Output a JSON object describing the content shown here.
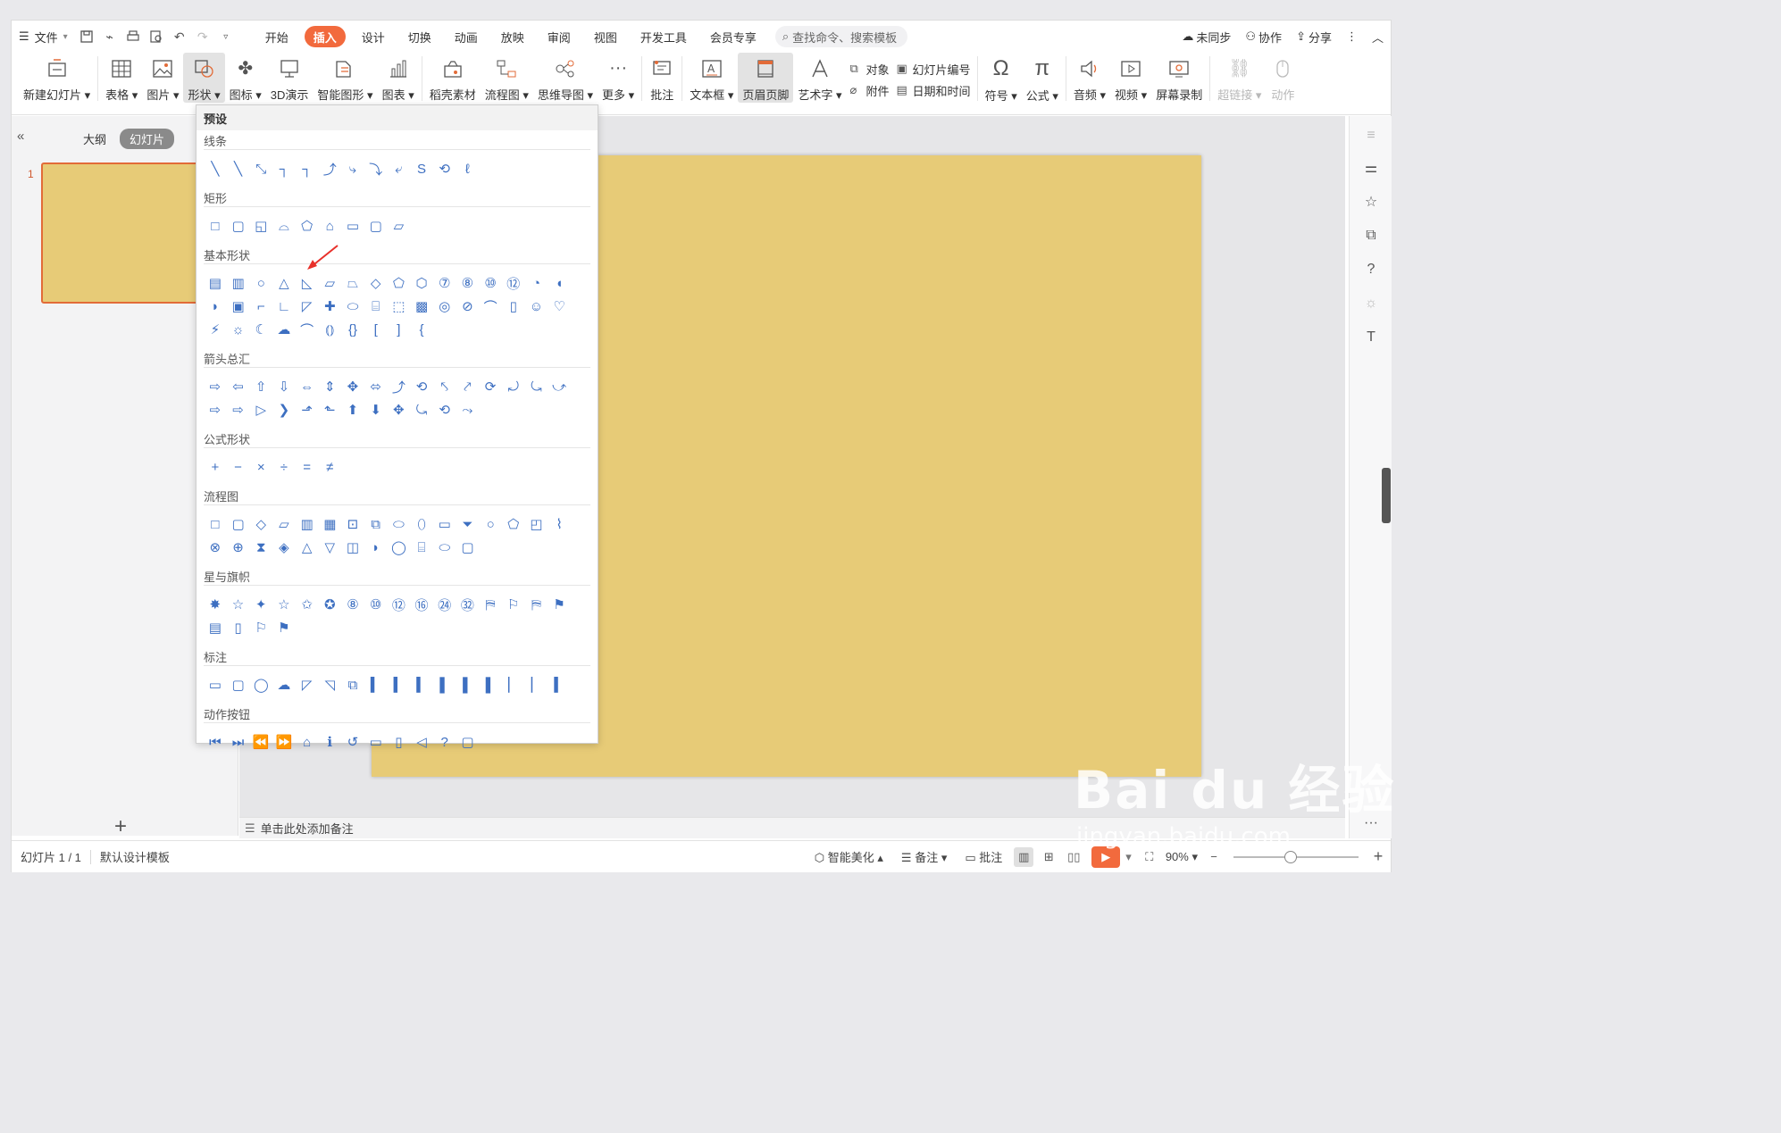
{
  "menubar": {
    "file": "文件",
    "tabs": [
      {
        "label": "开始",
        "active": false
      },
      {
        "label": "插入",
        "active": true
      },
      {
        "label": "设计",
        "active": false
      },
      {
        "label": "切换",
        "active": false
      },
      {
        "label": "动画",
        "active": false
      },
      {
        "label": "放映",
        "active": false
      },
      {
        "label": "审阅",
        "active": false
      },
      {
        "label": "视图",
        "active": false
      },
      {
        "label": "开发工具",
        "active": false
      },
      {
        "label": "会员专享",
        "active": false
      }
    ],
    "search_placeholder": "查找命令、搜索模板",
    "unsynced": "未同步",
    "collaborate": "协作",
    "share": "分享"
  },
  "ribbon": {
    "new_slide": "新建幻灯片",
    "table": "表格",
    "picture": "图片",
    "shape": "形状",
    "icon": "图标",
    "demo3d": "3D演示",
    "smartart": "智能图形",
    "chart": "图表",
    "material": "稻壳素材",
    "flowchart": "流程图",
    "mindmap": "思维导图",
    "more": "更多",
    "comment": "批注",
    "textbox": "文本框",
    "header_footer": "页眉页脚",
    "wordart": "艺术字",
    "object": "对象",
    "attachment": "附件",
    "slide_number": "幻灯片编号",
    "datetime": "日期和时间",
    "symbol": "符号",
    "formula": "公式",
    "audio": "音频",
    "video": "视频",
    "screen_record": "屏幕录制",
    "hyperlink": "超链接",
    "action": "动作"
  },
  "leftpanel": {
    "outline": "大纲",
    "slides": "幻灯片",
    "slide_index": "1"
  },
  "dropdown": {
    "header": "预设",
    "sections": [
      {
        "title": "线条",
        "count": 12
      },
      {
        "title": "矩形",
        "count": 9
      },
      {
        "title": "基本形状",
        "count": 42
      },
      {
        "title": "箭头总汇",
        "count": 28
      },
      {
        "title": "公式形状",
        "count": 6
      },
      {
        "title": "流程图",
        "count": 28
      },
      {
        "title": "星与旗帜",
        "count": 20
      },
      {
        "title": "标注",
        "count": 16
      },
      {
        "title": "动作按钮",
        "count": 12
      }
    ]
  },
  "notes": {
    "placeholder": "单击此处添加备注"
  },
  "statusbar": {
    "slide_info": "幻灯片 1 / 1",
    "template": "默认设计模板",
    "beautify": "智能美化",
    "notes": "备注",
    "comment": "批注",
    "zoom": "90%",
    "zoom_level": 0.45
  },
  "watermark": {
    "line1": "Bai du 经验",
    "line2": "jingyan.baidu.com"
  },
  "colors": {
    "accent": "#f26a3d",
    "slide_bg": "#e7cb77",
    "shape_icon": "#3d6fc1"
  }
}
